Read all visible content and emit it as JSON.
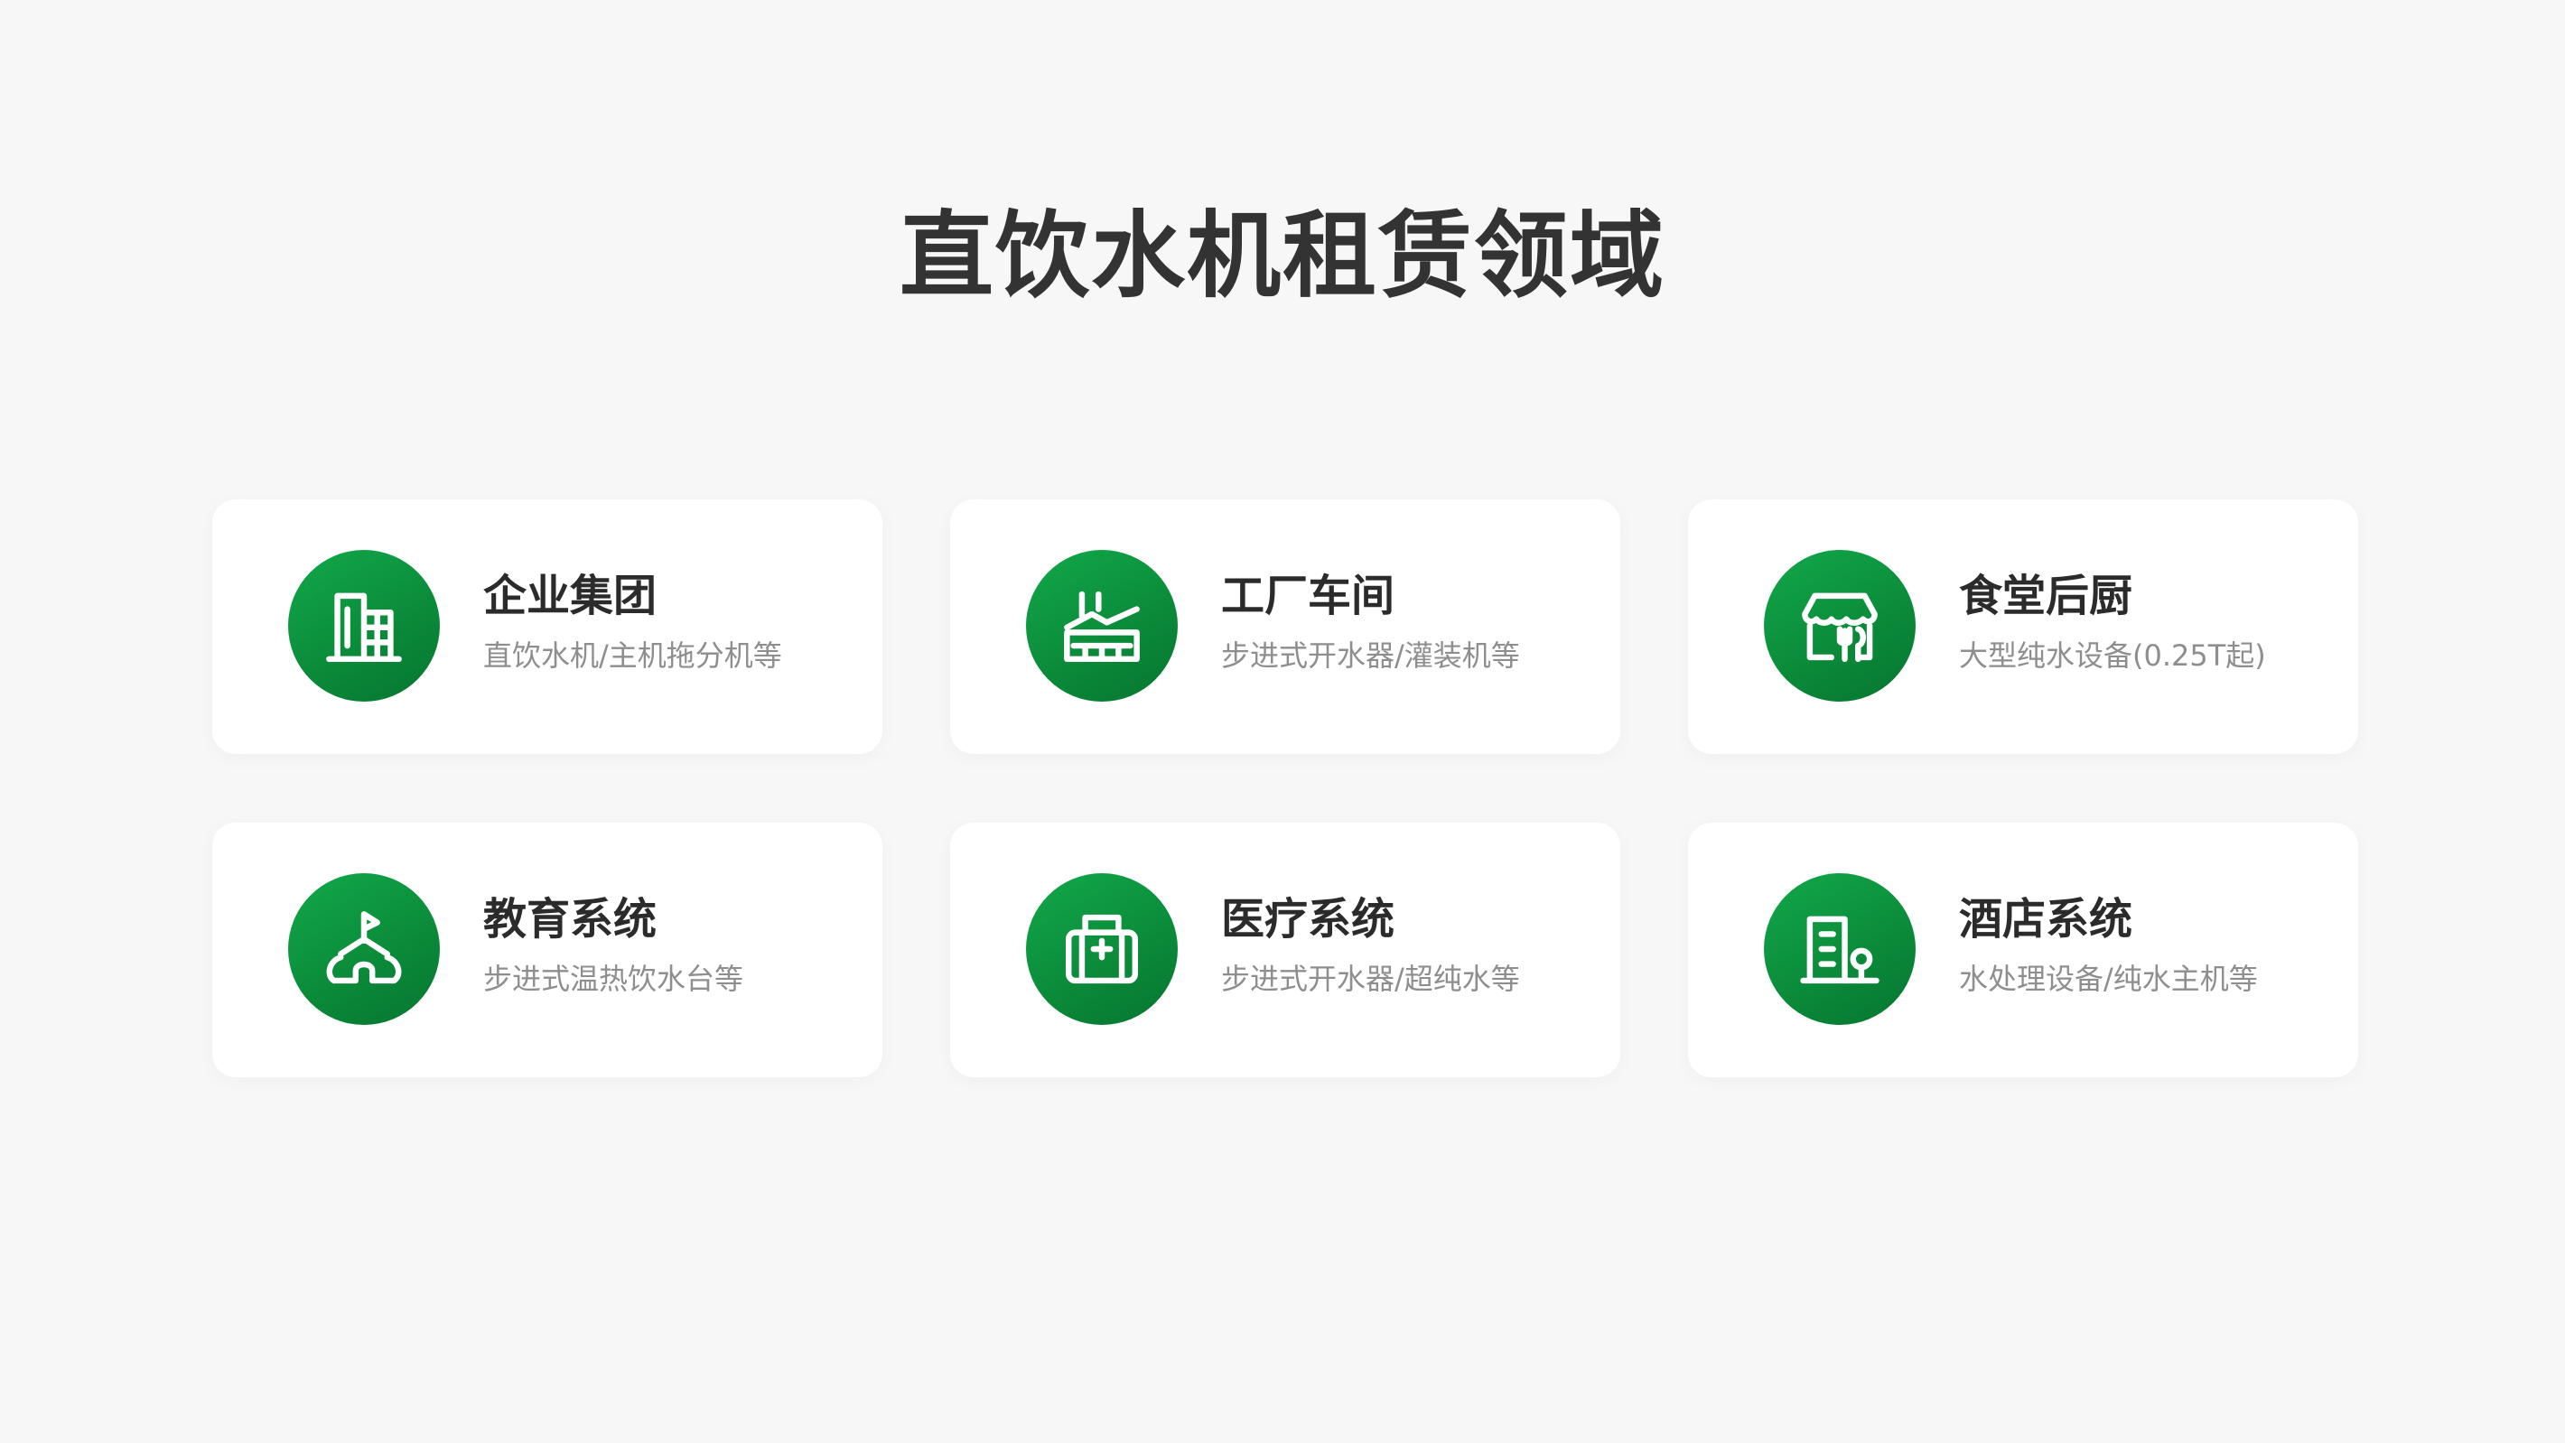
{
  "title": "直饮水机租赁领域",
  "cards": [
    {
      "title": "企业集团",
      "subtitle": "直饮水机/主机拖分机等",
      "icon": "office-building-icon"
    },
    {
      "title": "工厂车间",
      "subtitle": "步进式开水器/灌装机等",
      "icon": "factory-icon"
    },
    {
      "title": "食堂后厨",
      "subtitle": "大型纯水设备(0.25T起)",
      "icon": "canteen-store-icon"
    },
    {
      "title": "教育系统",
      "subtitle": "步进式温热饮水台等",
      "icon": "school-flag-icon"
    },
    {
      "title": "医疗系统",
      "subtitle": "步进式开水器/超纯水等",
      "icon": "hospital-icon"
    },
    {
      "title": "酒店系统",
      "subtitle": "水处理设备/纯水主机等",
      "icon": "hotel-building-icon"
    }
  ],
  "colors": {
    "accent": "#0b8c3a",
    "accent_light": "#12a84a",
    "background": "#f7f7f7",
    "card": "#ffffff",
    "title_text": "#333333",
    "subtitle_text": "#8e8e8e"
  }
}
